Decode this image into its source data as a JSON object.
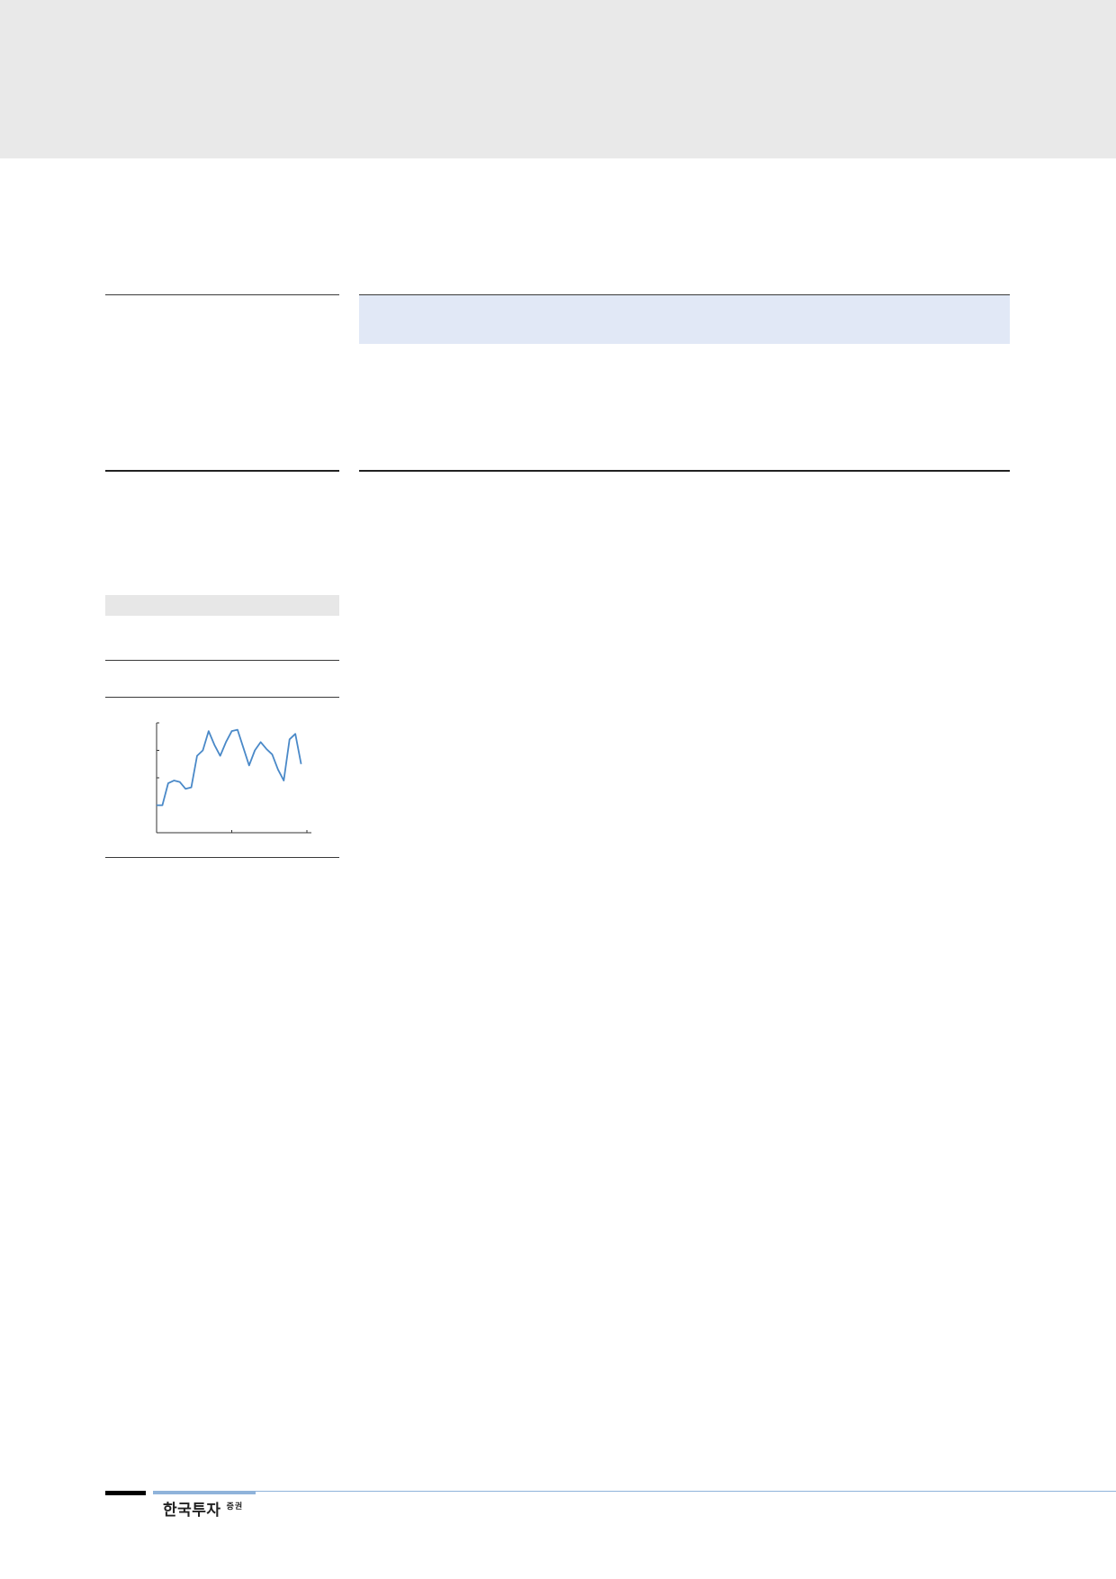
{
  "logo": {
    "main": "한국투자",
    "sub": "증권"
  },
  "colors": {
    "header_band": "#e9e9e9",
    "highlight_box": "#e1e8f6",
    "grey_bar": "#e7e7e7",
    "chart_line": "#4a89c8",
    "footer_accent": "#8fb3da"
  },
  "chart_data": {
    "type": "line",
    "title": "",
    "xlabel": "",
    "ylabel": "",
    "x": [
      0,
      1,
      2,
      3,
      4,
      5,
      6,
      7,
      8,
      9,
      10,
      11,
      12,
      13,
      14,
      15,
      16,
      17,
      18,
      19,
      20,
      21,
      22,
      23,
      24,
      25
    ],
    "series": [
      {
        "values": [
          1.0,
          1.0,
          1.8,
          1.9,
          1.85,
          1.6,
          1.65,
          2.8,
          3.0,
          3.7,
          3.2,
          2.8,
          3.3,
          3.7,
          3.75,
          3.1,
          2.45,
          3.0,
          3.3,
          3.05,
          2.85,
          2.3,
          1.9,
          3.4,
          3.6,
          2.5
        ]
      }
    ],
    "ylim": [
      0,
      4
    ],
    "xlim": [
      0,
      26
    ],
    "ticks": {
      "y": 4,
      "x": 2
    },
    "grid": false
  }
}
